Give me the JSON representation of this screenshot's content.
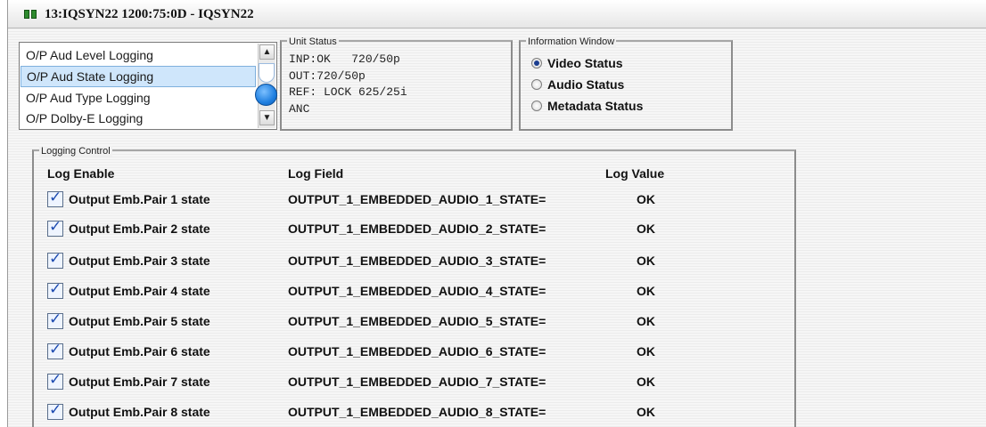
{
  "window": {
    "title": "13:IQSYN22  1200:75:0D  - IQSYN22"
  },
  "menu_list": {
    "items": [
      {
        "label": "O/P Aud Level Logging",
        "selected": false
      },
      {
        "label": "O/P Aud State Logging",
        "selected": true
      },
      {
        "label": "O/P Aud Type Logging",
        "selected": false
      },
      {
        "label": "O/P Dolby-E Logging",
        "selected": false
      }
    ]
  },
  "unit_status": {
    "legend": "Unit Status",
    "lines": [
      "INP:OK   720/50p",
      "OUT:720/50p",
      "REF: LOCK 625/25i",
      "ANC"
    ]
  },
  "information_window": {
    "legend": "Information Window",
    "options": [
      {
        "label": "Video Status",
        "selected": true
      },
      {
        "label": "Audio Status",
        "selected": false
      },
      {
        "label": "Metadata Status",
        "selected": false
      }
    ]
  },
  "logging_control": {
    "legend": "Logging Control",
    "headers": {
      "enable": "Log Enable",
      "field": "Log Field",
      "value": "Log Value"
    },
    "rows": [
      {
        "label": "Output Emb.Pair 1 state",
        "field": "OUTPUT_1_EMBEDDED_AUDIO_1_STATE=",
        "value": "OK",
        "checked": true
      },
      {
        "label": "Output Emb.Pair 2 state",
        "field": "OUTPUT_1_EMBEDDED_AUDIO_2_STATE=",
        "value": "OK",
        "checked": true
      },
      {
        "label": "Output Emb.Pair 3 state",
        "field": "OUTPUT_1_EMBEDDED_AUDIO_3_STATE=",
        "value": "OK",
        "checked": true
      },
      {
        "label": "Output Emb.Pair 4 state",
        "field": "OUTPUT_1_EMBEDDED_AUDIO_4_STATE=",
        "value": "OK",
        "checked": true
      },
      {
        "label": "Output Emb.Pair 5 state",
        "field": "OUTPUT_1_EMBEDDED_AUDIO_5_STATE=",
        "value": "OK",
        "checked": true
      },
      {
        "label": "Output Emb.Pair 6 state",
        "field": "OUTPUT_1_EMBEDDED_AUDIO_6_STATE=",
        "value": "OK",
        "checked": true
      },
      {
        "label": "Output Emb.Pair 7 state",
        "field": "OUTPUT_1_EMBEDDED_AUDIO_7_STATE=",
        "value": "OK",
        "checked": true
      },
      {
        "label": "Output Emb.Pair 8 state",
        "field": "OUTPUT_1_EMBEDDED_AUDIO_8_STATE=",
        "value": "OK",
        "checked": true
      }
    ]
  },
  "colors": {
    "selection": "#cfe6fb",
    "checkmark": "#1d4bb0",
    "scroll_thumb": "#1f7fe0"
  }
}
